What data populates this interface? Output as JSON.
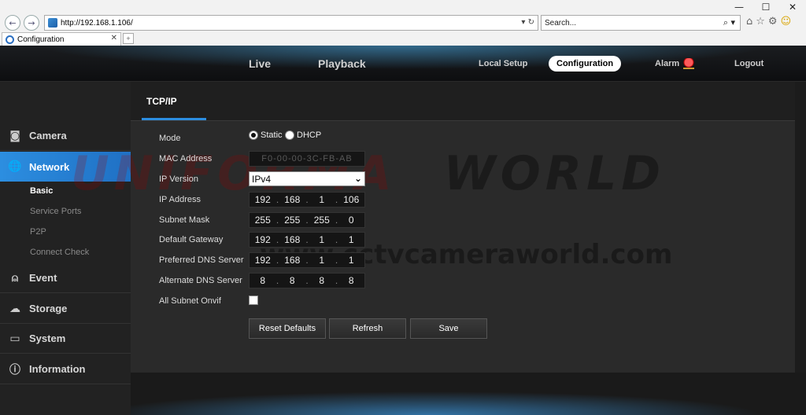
{
  "browser": {
    "window_buttons": [
      "—",
      "☐",
      "✕"
    ],
    "url": "http://192.168.1.106/",
    "address_tools": "▾ ↻",
    "search_placeholder": "Search...",
    "search_icon_text": "⌕ ▾",
    "tab_title": "Configuration",
    "tab_close": "✕"
  },
  "header": {
    "nav": {
      "live": "Live",
      "playback": "Playback",
      "local_setup": "Local Setup",
      "configuration": "Configuration",
      "alarm": "Alarm",
      "logout": "Logout"
    }
  },
  "sidebar": {
    "camera": "Camera",
    "network": "Network",
    "sub": {
      "basic": "Basic",
      "service_ports": "Service Ports",
      "p2p": "P2P",
      "connect_check": "Connect Check"
    },
    "event": "Event",
    "storage": "Storage",
    "system": "System",
    "information": "Information"
  },
  "panel": {
    "tab_title": "TCP/IP",
    "labels": {
      "mode": "Mode",
      "mac": "MAC Address",
      "ip_version": "IP Version",
      "ip_address": "IP Address",
      "subnet_mask": "Subnet Mask",
      "gateway": "Default Gateway",
      "preferred_dns": "Preferred DNS Server",
      "alternate_dns": "Alternate DNS Server",
      "all_subnet_onvif": "All Subnet Onvif"
    },
    "mode_options": {
      "static": "Static",
      "dhcp": "DHCP"
    },
    "mode_selected": "Static",
    "mac_value": "F0-00-00-3C-FB-AB",
    "ip_version_value": "IPv4",
    "ip_address": [
      "192",
      "168",
      "1",
      "106"
    ],
    "subnet_mask": [
      "255",
      "255",
      "255",
      "0"
    ],
    "gateway": [
      "192",
      "168",
      "1",
      "1"
    ],
    "preferred_dns": [
      "192",
      "168",
      "1",
      "1"
    ],
    "alternate_dns": [
      "8",
      "8",
      "8",
      "8"
    ],
    "all_subnet_onvif_checked": false,
    "buttons": {
      "reset": "Reset Defaults",
      "refresh": "Refresh",
      "save": "Save"
    }
  },
  "watermark": {
    "line1a": "UNIFORMA",
    "line1b": "WORLD",
    "url": "www.cctvcameraworld.com"
  },
  "colors": {
    "accent": "#2c8ee0",
    "panel_bg": "#2a2a2a",
    "field_bg": "#151515"
  }
}
